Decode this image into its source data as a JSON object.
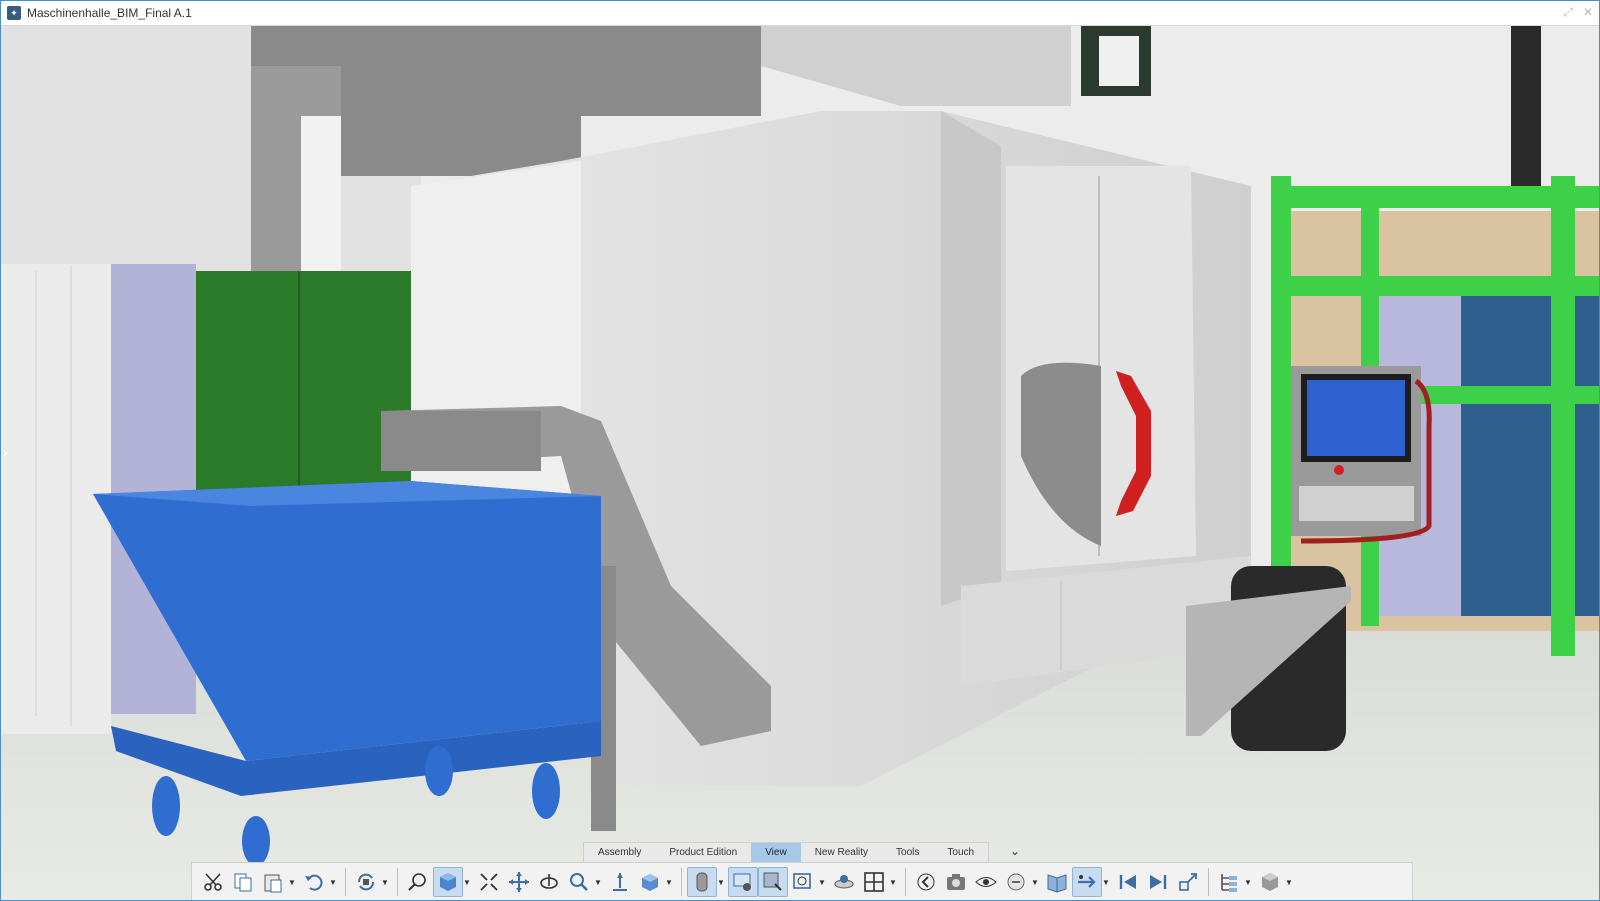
{
  "window": {
    "title": "Maschinenhalle_BIM_Final A.1"
  },
  "tabs": [
    {
      "label": "Assembly"
    },
    {
      "label": "Product Edition"
    },
    {
      "label": "View",
      "active": true
    },
    {
      "label": "New Reality"
    },
    {
      "label": "Tools"
    },
    {
      "label": "Touch"
    }
  ],
  "toolbar_icons": [
    "cut-icon",
    "copy-icon",
    "paste-icon",
    "undo-icon",
    "refresh-icon",
    "zoom-area-icon",
    "view-cube-icon",
    "fit-all-icon",
    "pan-icon",
    "rotate-icon",
    "zoom-icon",
    "normal-view-icon",
    "iso-view-icon",
    "render-style-icon",
    "ambient-occlusion-icon",
    "shading-icon",
    "capture-icon",
    "lens-icon",
    "layout-icon",
    "previous-icon",
    "camera-icon",
    "look-at-icon",
    "walk-icon",
    "book-icon",
    "fly-icon",
    "first-frame-icon",
    "last-frame-icon",
    "explode-icon",
    "tree-icon",
    "object-icon"
  ],
  "colors": {
    "accent": "#a8c8e8",
    "bin_blue": "#2f6dd0",
    "cabinet_green": "#2a7a2a",
    "shelf_green": "#3fd04a",
    "handle_red": "#d02020",
    "screen_blue": "#2f60d0"
  }
}
